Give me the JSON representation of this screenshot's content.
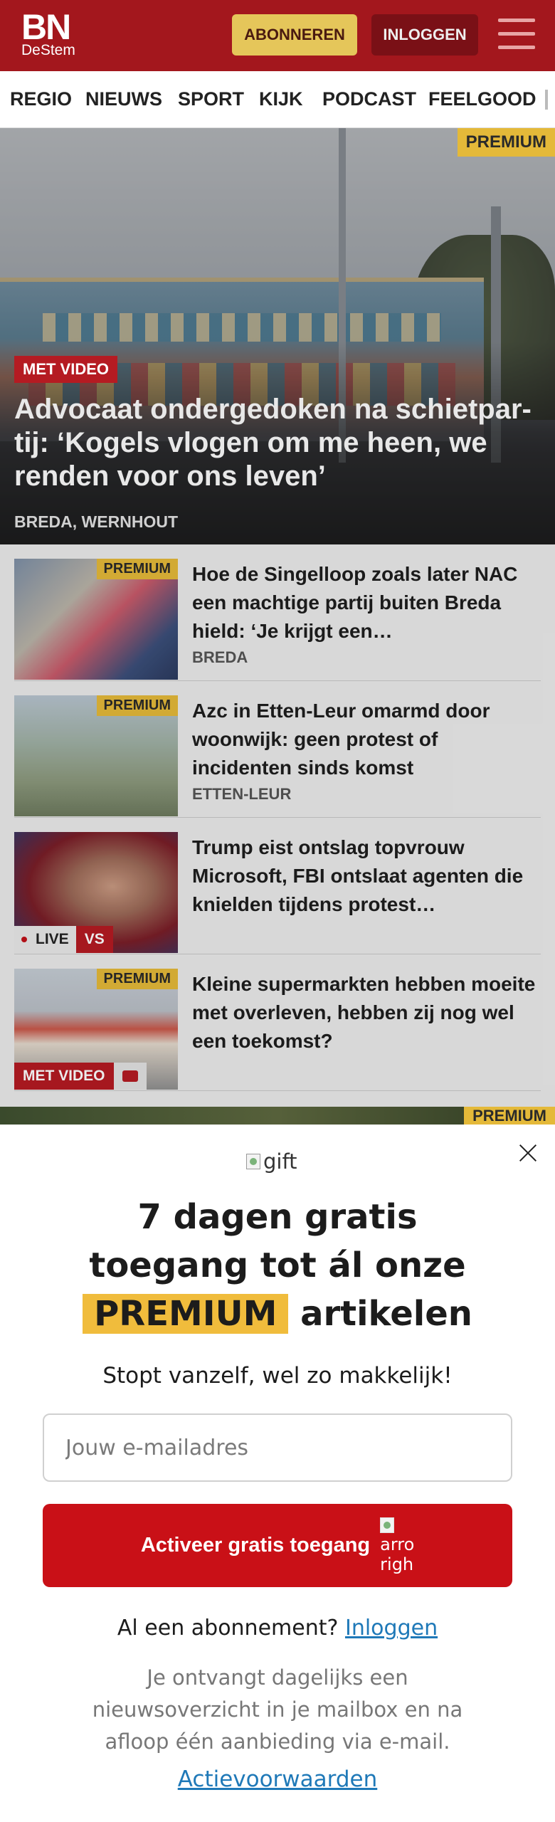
{
  "header": {
    "logo_main": "BN",
    "logo_sub": "DeStem",
    "subscribe_label": "ABONNEREN",
    "login_label": "INLOGGEN"
  },
  "nav": {
    "items": [
      "REGIO",
      "NIEUWS",
      "SPORT",
      "KIJK",
      "PODCAST",
      "FEELGOOD"
    ]
  },
  "hero": {
    "premium": "PREMIUM",
    "video_tag": "MET VIDEO",
    "title": "Advocaat ondergedoken na schietpar­tij: ‘Kogels vlogen om me heen, we renden voor ons leven’",
    "location": "BREDA, WERNHOUT"
  },
  "articles": [
    {
      "premium": "PREMIUM",
      "title": "Hoe de Singelloop zoals later NAC een machtige partij buiten Breda hield: ‘Je krijgt een…",
      "location": "BREDA"
    },
    {
      "premium": "PREMIUM",
      "title": "Azc in Etten-Leur omarmd door woonwijk: geen protest of incidenten sinds komst",
      "location": "ETTEN-LEUR"
    },
    {
      "title": "Trump eist ontslag topvrouw Microsoft, FBI ontslaat agenten die knielden tijdens protest…",
      "live_label": "LIVE",
      "vs_label": "VS"
    },
    {
      "premium": "PREMIUM",
      "title": "Kleine supermarkten hebben moeite met overleven, hebben zij nog wel een toekomst?",
      "video_tag": "MET VIDEO"
    }
  ],
  "next_premium": "PREMIUM",
  "modal": {
    "gift_alt": "gift",
    "heading_line1": "7 dagen gratis",
    "heading_line2": "toegang tot ál onze",
    "heading_highlight": "PREMIUM",
    "heading_line3_rest": "artikelen",
    "subheading": "Stopt vanzelf, wel zo makkelijk!",
    "email_placeholder": "Jouw e-mailadres",
    "cta_label": "Activeer gratis toegang",
    "cta_icon_alt_1": "arro",
    "cta_icon_alt_2": "righ",
    "already_text": "Al een abonnement?",
    "login_link": "Inloggen",
    "disclaimer": "Je ontvangt dagelijks een nieuwsoverzicht in je mailbox en na afloop één aanbieding via e-mail.",
    "terms_link": "Actievoorwaarden"
  },
  "colors": {
    "brand_red": "#a3171d",
    "premium_yellow": "#e4b939",
    "cta_red": "#c91017",
    "link_blue": "#1f79b8"
  }
}
